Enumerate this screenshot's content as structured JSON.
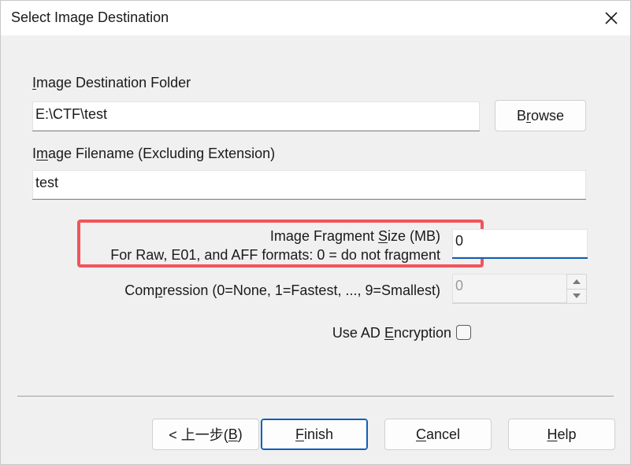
{
  "window": {
    "title": "Select Image Destination"
  },
  "destination": {
    "label_pre": "",
    "label_key": "I",
    "label_post": "mage Destination Folder",
    "value": "E:\\CTF\\test",
    "browse_pre": "B",
    "browse_key": "r",
    "browse_post": "owse"
  },
  "filename": {
    "label_pre": "I",
    "label_key": "m",
    "label_post": "age Filename (Excluding Extension)",
    "value": "test"
  },
  "fragment": {
    "label1_pre": "Image Fragment ",
    "label1_key": "S",
    "label1_post": "ize (MB)",
    "label2": "For Raw, E01, and AFF formats: 0 = do not fragment",
    "value": "0"
  },
  "compression": {
    "label_pre": "Com",
    "label_key": "p",
    "label_post": "ression (0=None, 1=Fastest, ..., 9=Smallest)",
    "value": "0"
  },
  "encryption": {
    "label_pre": "Use AD ",
    "label_key": "E",
    "label_post": "ncryption",
    "checked": false
  },
  "buttons": {
    "back_pre": "< 上一步(",
    "back_key": "B",
    "back_post": ")",
    "finish_key": "F",
    "finish_post": "inish",
    "cancel_key": "C",
    "cancel_post": "ancel",
    "help_key": "H",
    "help_post": "elp"
  },
  "colors": {
    "highlight": "#f2545b",
    "accent": "#0f5fb8"
  }
}
